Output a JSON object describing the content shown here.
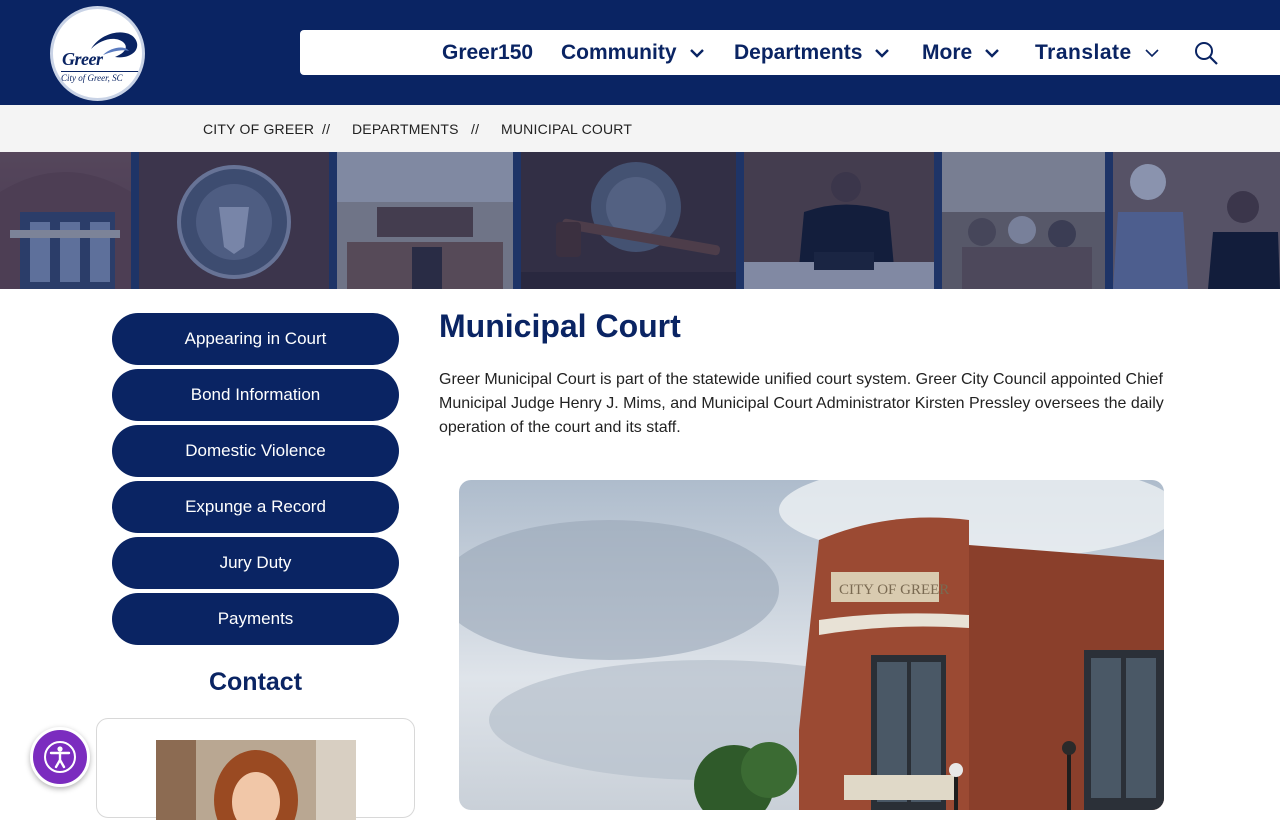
{
  "header": {
    "logo_word": "Greer",
    "logo_sub": "City of Greer, SC",
    "nav": [
      {
        "label": "Greer150",
        "has_dropdown": false
      },
      {
        "label": "Community",
        "has_dropdown": true
      },
      {
        "label": "Departments",
        "has_dropdown": true
      },
      {
        "label": "More",
        "has_dropdown": true
      },
      {
        "label": "Translate",
        "has_dropdown": true
      }
    ],
    "search_icon": "search-icon"
  },
  "breadcrumb": {
    "items": [
      "CITY OF GREER",
      "DEPARTMENTS",
      "MUNICIPAL COURT"
    ],
    "separator": "//"
  },
  "sidebar": {
    "links": [
      "Appearing in Court",
      "Bond Information",
      "Domestic Violence",
      "Expunge a Record",
      "Jury Duty",
      "Payments"
    ],
    "contact_heading": "Contact"
  },
  "main": {
    "title": "Municipal Court",
    "intro": "Greer Municipal Court is part of the statewide unified court system. Greer City Council appointed Chief Municipal Judge Henry J. Mims, and Municipal Court Administrator Kirsten Pressley oversees the daily operation of the court and its staff."
  },
  "colors": {
    "brand_navy": "#0a2463",
    "breadcrumb_bg": "#f4f4f4",
    "accessibility_purple": "#7b2cbf"
  },
  "icons": [
    "chevron-down-icon",
    "search-icon",
    "accessibility-icon"
  ]
}
